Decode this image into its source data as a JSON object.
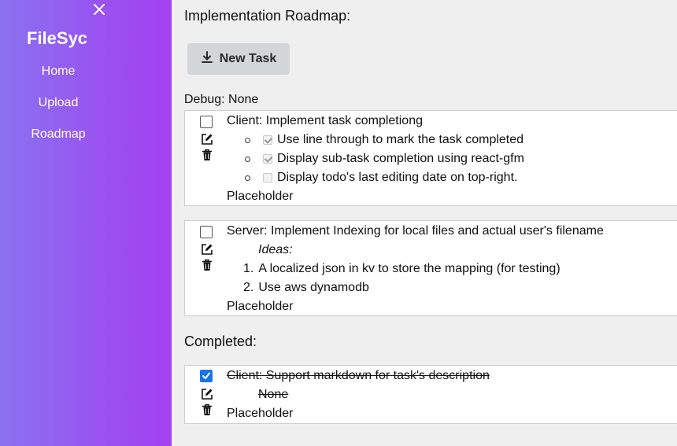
{
  "sidebar": {
    "brand": "FileSyc",
    "nav": [
      {
        "label": "Home"
      },
      {
        "label": "Upload"
      },
      {
        "label": "Roadmap"
      }
    ]
  },
  "main": {
    "title": "Implementation Roadmap:",
    "new_task_label": "New Task",
    "debug_text": "Debug: None",
    "tasks": [
      {
        "title": "Client: Implement task completiong",
        "subtasks": [
          {
            "text": "Use line through to mark the task completed",
            "checked": true
          },
          {
            "text": "Display sub-task completion using react-gfm",
            "checked": true
          },
          {
            "text": "Display todo's last editing date on top-right.",
            "checked": false
          }
        ],
        "footer": "Placeholder"
      },
      {
        "title": "Server: Implement Indexing for local files and actual user's filename",
        "ideas_label": "Ideas:",
        "ideas": [
          {
            "num": "1.",
            "text": "A localized json in kv to store the mapping (for testing)"
          },
          {
            "num": "2.",
            "text": "Use aws dynamodb"
          }
        ],
        "footer": "Placeholder"
      }
    ],
    "completed_title": "Completed:",
    "completed": [
      {
        "title": "Client: Support markdown for task's description",
        "description": "None",
        "footer": "Placeholder",
        "checked": true
      }
    ]
  },
  "colors": {
    "sidebar_start": "#8a72f0",
    "sidebar_end": "#a341f0",
    "checkbox_checked": "#1a73e8",
    "button_bg": "#d3d6d9"
  }
}
